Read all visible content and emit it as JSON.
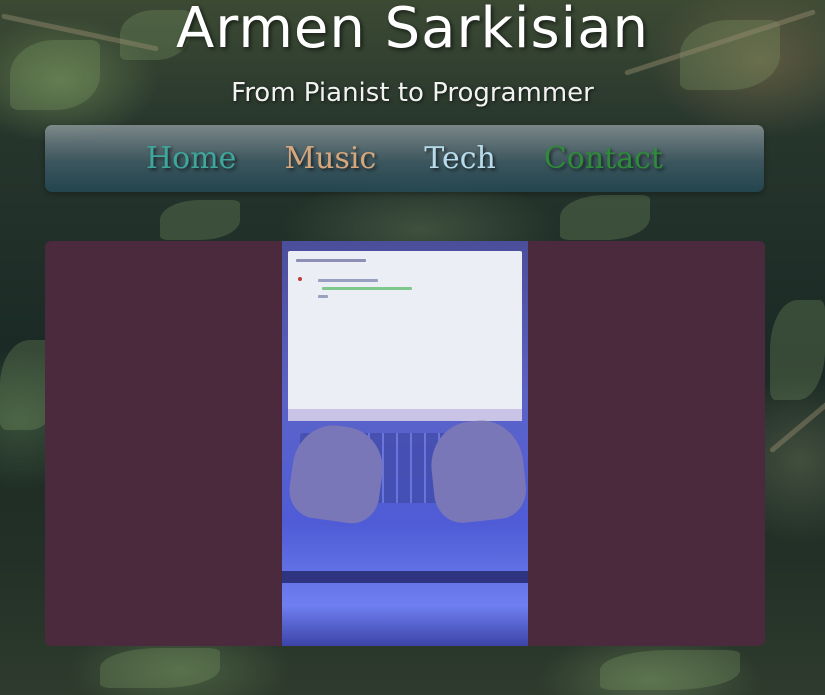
{
  "header": {
    "title": "Armen Sarkisian",
    "subtitle": "From Pianist to Programmer"
  },
  "nav": {
    "items": [
      {
        "label": "Home",
        "color": "#3fa69b"
      },
      {
        "label": "Music",
        "color": "#d6a77d"
      },
      {
        "label": "Tech",
        "color": "#b9dcec"
      },
      {
        "label": "Contact",
        "color": "#2f8a3a"
      }
    ]
  },
  "main": {
    "panel_color": "#4a2a3c",
    "media": {
      "type": "video",
      "icon": "video-icon"
    }
  },
  "background": {
    "icon": "foliage-background"
  }
}
